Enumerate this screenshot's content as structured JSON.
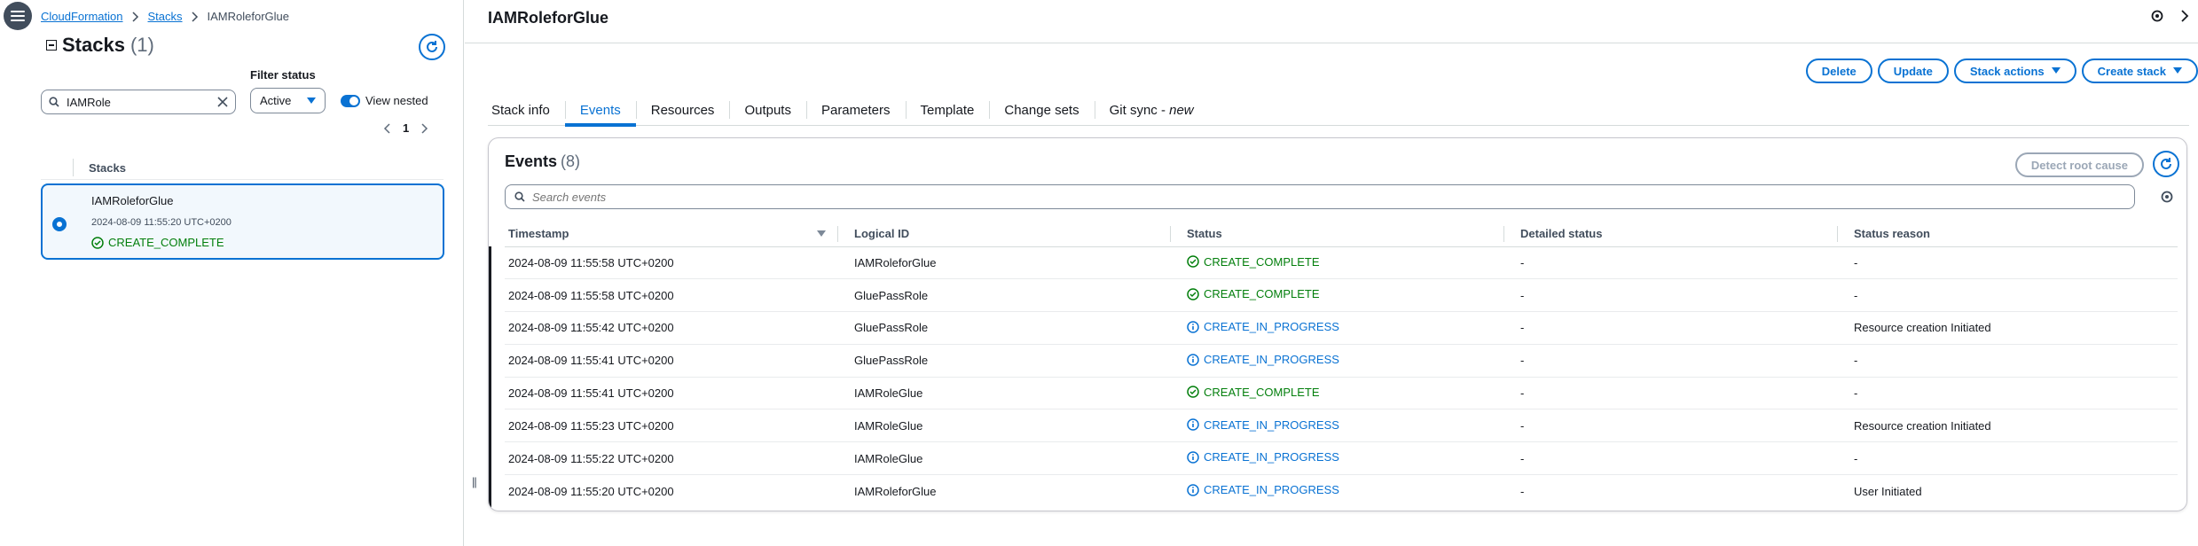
{
  "breadcrumb": {
    "items": [
      "CloudFormation",
      "Stacks"
    ],
    "current": "IAMRoleforGlue"
  },
  "sidebar": {
    "title": "Stacks",
    "count": "(1)",
    "filter_label": "Filter status",
    "search_value": "IAMRole",
    "filter_value": "Active",
    "view_nested_label": "View nested",
    "page": "1",
    "column_header": "Stacks",
    "stack": {
      "name": "IAMRoleforGlue",
      "time": "2024-08-09 11:55:20 UTC+0200",
      "status": "CREATE_COMPLETE"
    }
  },
  "main": {
    "title": "IAMRoleforGlue",
    "actions": {
      "delete": "Delete",
      "update": "Update",
      "stack_actions": "Stack actions",
      "create_stack": "Create stack"
    },
    "tabs": [
      "Stack info",
      "Events",
      "Resources",
      "Outputs",
      "Parameters",
      "Template",
      "Change sets"
    ],
    "git_sync": {
      "label": "Git sync - ",
      "badge": "new"
    },
    "active_tab": "Events"
  },
  "events": {
    "title": "Events",
    "count": "(8)",
    "detect_label": "Detect root cause",
    "search_placeholder": "Search events",
    "columns": [
      "Timestamp",
      "Logical ID",
      "Status",
      "Detailed status",
      "Status reason"
    ],
    "rows": [
      {
        "timestamp": "2024-08-09 11:55:58 UTC+0200",
        "logical_id": "IAMRoleforGlue",
        "status": "CREATE_COMPLETE",
        "detailed": "-",
        "reason": "-"
      },
      {
        "timestamp": "2024-08-09 11:55:58 UTC+0200",
        "logical_id": "GluePassRole",
        "status": "CREATE_COMPLETE",
        "detailed": "-",
        "reason": "-"
      },
      {
        "timestamp": "2024-08-09 11:55:42 UTC+0200",
        "logical_id": "GluePassRole",
        "status": "CREATE_IN_PROGRESS",
        "detailed": "-",
        "reason": "Resource creation Initiated"
      },
      {
        "timestamp": "2024-08-09 11:55:41 UTC+0200",
        "logical_id": "GluePassRole",
        "status": "CREATE_IN_PROGRESS",
        "detailed": "-",
        "reason": "-"
      },
      {
        "timestamp": "2024-08-09 11:55:41 UTC+0200",
        "logical_id": "IAMRoleGlue",
        "status": "CREATE_COMPLETE",
        "detailed": "-",
        "reason": "-"
      },
      {
        "timestamp": "2024-08-09 11:55:23 UTC+0200",
        "logical_id": "IAMRoleGlue",
        "status": "CREATE_IN_PROGRESS",
        "detailed": "-",
        "reason": "Resource creation Initiated"
      },
      {
        "timestamp": "2024-08-09 11:55:22 UTC+0200",
        "logical_id": "IAMRoleGlue",
        "status": "CREATE_IN_PROGRESS",
        "detailed": "-",
        "reason": "-"
      },
      {
        "timestamp": "2024-08-09 11:55:20 UTC+0200",
        "logical_id": "IAMRoleforGlue",
        "status": "CREATE_IN_PROGRESS",
        "detailed": "-",
        "reason": "User Initiated"
      }
    ]
  },
  "colors": {
    "accent": "#0972d3",
    "success": "#037f0c",
    "text": "#16191f"
  }
}
